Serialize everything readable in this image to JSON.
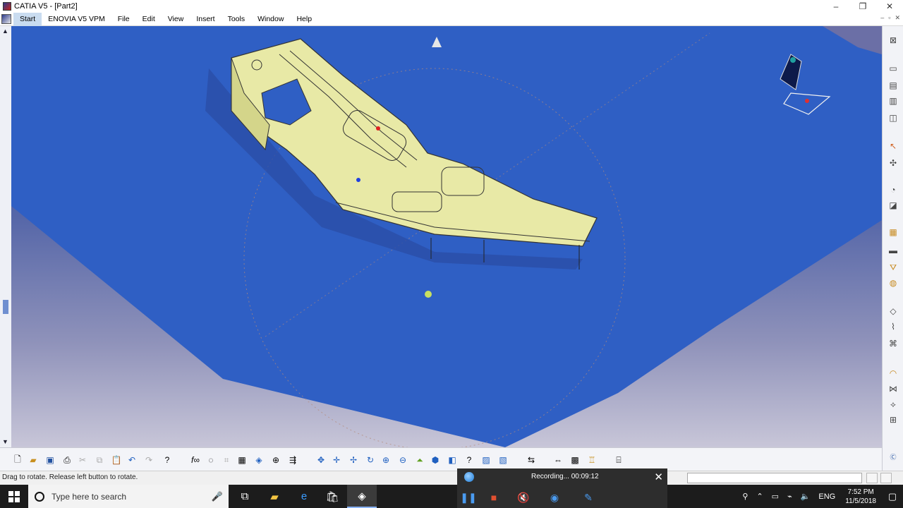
{
  "window": {
    "title": "CATIA V5 - [Part2]",
    "controls": [
      "–",
      "❐",
      "✕"
    ]
  },
  "menu": {
    "items": [
      "Start",
      "ENOVIA V5 VPM",
      "File",
      "Edit",
      "View",
      "Insert",
      "Tools",
      "Window",
      "Help"
    ]
  },
  "mdi_controls": [
    "–",
    "▫",
    "✕"
  ],
  "status": {
    "text": "Drag to rotate. Release left button to rotate."
  },
  "recorder": {
    "label": "Recording... 00:09:12"
  },
  "taskbar": {
    "search_placeholder": "Type here to search",
    "language": "ENG",
    "time": "7:52 PM",
    "date": "11/5/2018"
  },
  "colors": {
    "viewport_background": "#3a4e9a",
    "ground_plane": "#2f5fc4",
    "part_surface": "#e8e9a6",
    "accent": "#8ab4f8",
    "recorder_bg": "#2d2d2d",
    "taskbar_bg": "#1c1c1c"
  },
  "icons": {
    "right_toolbar": [
      "exit-icon",
      "sketch-icon",
      "pad-icon",
      "pocket-icon",
      "shaft-icon",
      "select-icon",
      "compass-icon",
      "fillet-icon",
      "chamfer-icon",
      "draft-icon",
      "shell-icon",
      "thickness-icon",
      "hole-icon",
      "thread-icon",
      "rib-icon",
      "slot-icon",
      "stiffener-icon",
      "loft-icon",
      "split-icon"
    ],
    "bottom_toolbar": [
      "new-icon",
      "open-icon",
      "save-icon",
      "print-icon",
      "cut-icon",
      "copy-icon",
      "paste-icon",
      "undo-icon",
      "redo-icon",
      "whats-this-icon",
      "formula-icon",
      "comment-icon",
      "snap-icon",
      "grid-icon",
      "hide-show-icon",
      "swap-icon",
      "fit-all-icon",
      "pan-icon",
      "rotate-icon",
      "zoom-in-icon",
      "zoom-out-icon",
      "normal-view-icon",
      "iso-view-icon",
      "view-mode-icon",
      "shading-icon",
      "hide-icon",
      "measure-icon",
      "multi-view-icon",
      "analysis-icon",
      "apply-material-icon",
      "camera-icon"
    ]
  }
}
